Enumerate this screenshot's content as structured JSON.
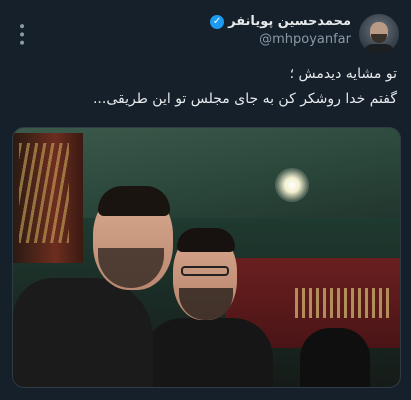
{
  "tweet": {
    "display_name": "محمدحسین پویانفر",
    "handle": "@mhpoyanfar",
    "text_line1": "تو مشایه دیدمش ؛",
    "text_line2": "گفتم خدا روشکر کن به جای مجلس تو این طریقی...",
    "verified_icon": "✓",
    "menu_icon": "•••"
  },
  "colors": {
    "background": "#15202b",
    "text": "#e7e9ea",
    "secondary": "#8b98a5",
    "verified": "#1d9bf0"
  }
}
